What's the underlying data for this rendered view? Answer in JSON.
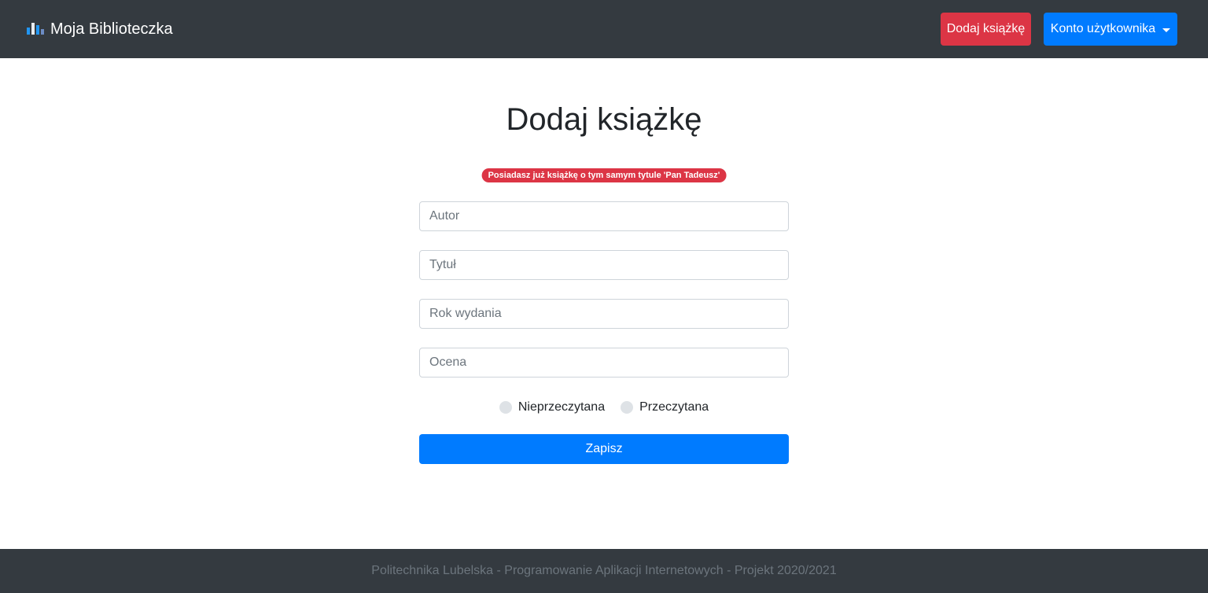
{
  "navbar": {
    "brand": {
      "icon": "bar-chart-icon",
      "label": "Moja Biblioteczka"
    },
    "add_book_label": "Dodaj książkę",
    "account_label": "Konto użytkownika",
    "account_icon": "caret-down-icon"
  },
  "main": {
    "title": "Dodaj książkę",
    "alert": "Posiadasz już książkę o tym samym tytule 'Pan Tadeusz'",
    "fields": {
      "author": {
        "placeholder": "Autor",
        "value": ""
      },
      "title": {
        "placeholder": "Tytuł",
        "value": ""
      },
      "year": {
        "placeholder": "Rok wydania",
        "value": ""
      },
      "rating": {
        "placeholder": "Ocena",
        "value": ""
      }
    },
    "status_options": [
      {
        "label": "Nieprzeczytana",
        "checked": false
      },
      {
        "label": "Przeczytana",
        "checked": false
      }
    ],
    "submit_label": "Zapisz"
  },
  "footer": {
    "text": "Politechnika Lubelska - Programowanie Aplikacji Internetowych - Projekt 2020/2021"
  },
  "colors": {
    "navbar_bg": "#343a40",
    "danger": "#dc3545",
    "primary": "#007bff",
    "footer_text": "#6c757d"
  }
}
